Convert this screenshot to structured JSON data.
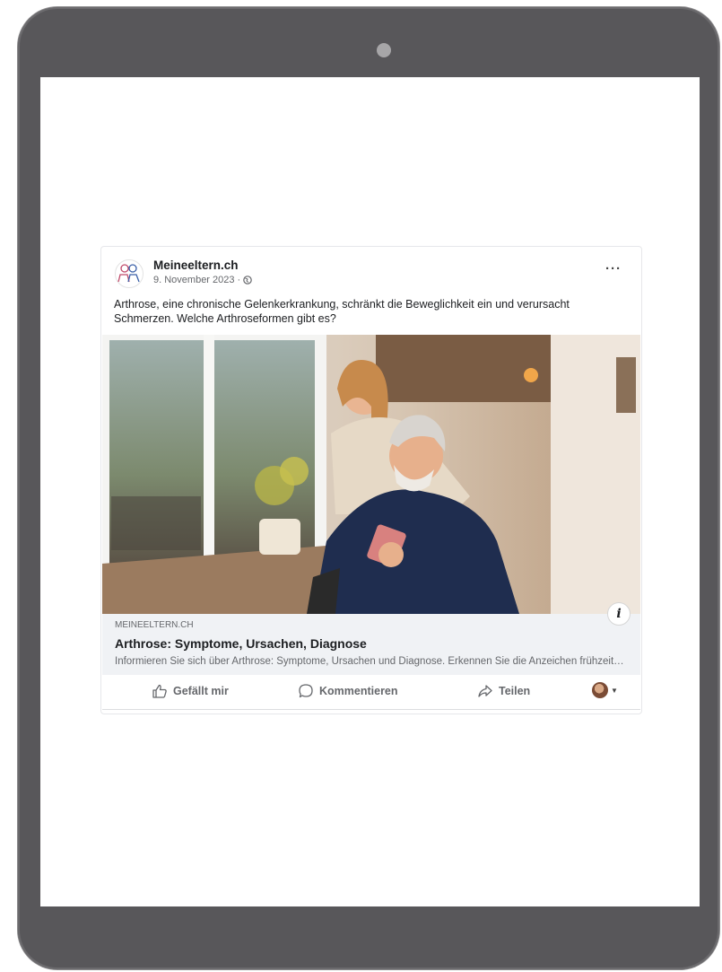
{
  "post": {
    "page_name": "Meineeltern.ch",
    "date": "9. November 2023 ·",
    "text": "Arthrose, eine chronische Gelenkerkrankung, schränkt die Beweglichkeit ein und verursacht Schmerzen. Welche Arthroseformen gibt es?",
    "more_label": "···",
    "info_label": "i"
  },
  "link": {
    "domain": "MEINEELTERN.CH",
    "title": "Arthrose: Symptome, Ursachen, Diagnose",
    "description": "Informieren Sie sich über Arthrose: Symptome, Ursachen und Diagnose. Erkennen Sie die Anzeichen frühzeitig und erfahren Sie mehr."
  },
  "actions": {
    "like": "Gefällt mir",
    "comment": "Kommentieren",
    "share": "Teilen"
  },
  "icons": {
    "avatar": "people-logo-icon",
    "audience": "globe-icon",
    "like": "thumbs-up-icon",
    "comment": "speech-bubble-icon",
    "share": "share-arrow-icon"
  },
  "colors": {
    "device_frame": "#58575a",
    "text_primary": "#1c1e21",
    "text_secondary": "#65676b",
    "link_box": "#f0f2f5"
  }
}
